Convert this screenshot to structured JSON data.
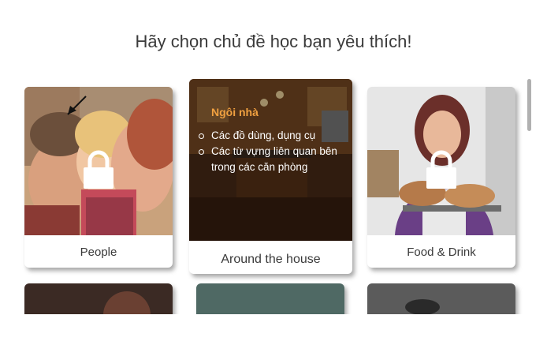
{
  "heading": "Hãy chọn chủ đề học bạn yêu thích!",
  "topics": [
    {
      "label": "People",
      "locked": true
    },
    {
      "label": "Around the house",
      "locked": false,
      "active": true,
      "overlay_title": "Ngôi nhà",
      "overlay_items": [
        "Các đồ dùng, dụng cụ",
        "Các từ vựng liên quan bên trong các căn phòng"
      ]
    },
    {
      "label": "Food & Drink",
      "locked": true
    }
  ],
  "colors": {
    "overlay_title": "#f0a040",
    "card_bg": "#ffffff",
    "text": "#3b3b3b"
  },
  "icons": [
    "lock-icon",
    "lock-icon"
  ]
}
